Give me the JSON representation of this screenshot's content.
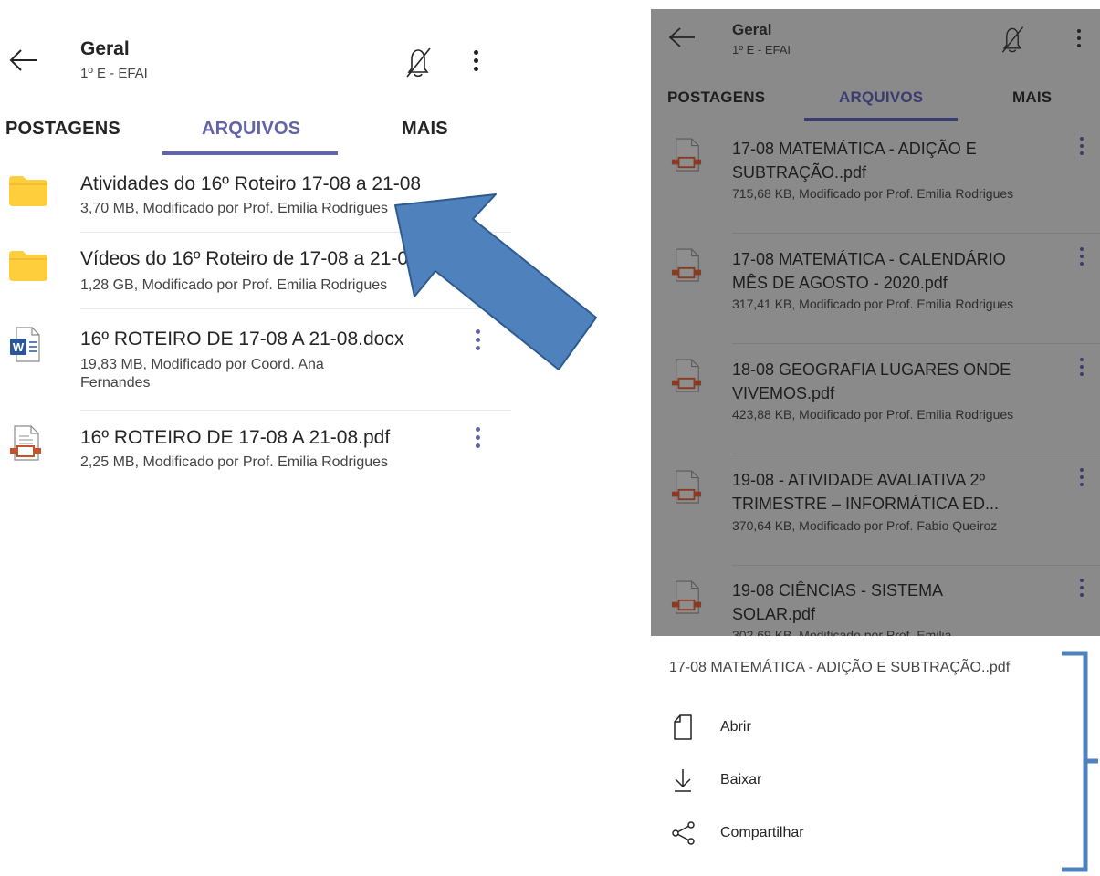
{
  "left": {
    "header": {
      "title": "Geral",
      "subtitle": "1º E - EFAI"
    },
    "tabs": [
      {
        "label": "POSTAGENS",
        "active": false
      },
      {
        "label": "ARQUIVOS",
        "active": true
      },
      {
        "label": "MAIS",
        "active": false
      }
    ],
    "files": [
      {
        "type": "folder",
        "name": "Atividades do 16º Roteiro 17-08 a 21-08",
        "meta": "3,70 MB, Modificado por Prof. Emilia Rodrigues"
      },
      {
        "type": "folder",
        "name": "Vídeos do 16º Roteiro de 17-08 a 21-08",
        "meta": "1,28 GB, Modificado por Prof. Emilia Rodrigues"
      },
      {
        "type": "docx",
        "name": "16º ROTEIRO DE 17-08 A 21-08.docx",
        "meta": "19,83 MB, Modificado por Coord. Ana Fernandes"
      },
      {
        "type": "pdf",
        "name": "16º ROTEIRO DE 17-08 A 21-08.pdf",
        "meta": "2,25 MB, Modificado por Prof. Emilia Rodrigues"
      }
    ]
  },
  "right": {
    "header": {
      "title": "Geral",
      "subtitle": "1º E - EFAI"
    },
    "tabs": [
      {
        "label": "POSTAGENS",
        "active": false
      },
      {
        "label": "ARQUIVOS",
        "active": true
      },
      {
        "label": "MAIS",
        "active": false
      }
    ],
    "files": [
      {
        "name": "17-08 MATEMÁTICA - ADIÇÃO E SUBTRAÇÃO..pdf",
        "meta": "715,68 KB, Modificado por Prof. Emilia Rodrigues"
      },
      {
        "name": "17-08 MATEMÁTICA - CALENDÁRIO MÊS DE AGOSTO - 2020.pdf",
        "meta": "317,41 KB, Modificado por Prof. Emilia Rodrigues"
      },
      {
        "name": "18-08 GEOGRAFIA LUGARES ONDE VIVEMOS.pdf",
        "meta": "423,88 KB, Modificado por Prof. Emilia Rodrigues"
      },
      {
        "name": "19-08 - ATIVIDADE AVALIATIVA 2º TRIMESTRE – INFORMÁTICA ED...",
        "meta": "370,64 KB, Modificado por Prof. Fabio Queiroz"
      },
      {
        "name": "19-08 CIÊNCIAS - SISTEMA SOLAR.pdf",
        "meta": "302,69 KB, Modificado por Prof. Emilia"
      }
    ],
    "sheet": {
      "title": "17-08 MATEMÁTICA - ADIÇÃO E SUBTRAÇÃO..pdf",
      "actions": [
        {
          "label": "Abrir",
          "icon": "file-icon"
        },
        {
          "label": "Baixar",
          "icon": "download-icon"
        },
        {
          "label": "Compartilhar",
          "icon": "share-icon"
        }
      ]
    }
  },
  "colors": {
    "accent": "#6264a7",
    "folder": "#ffce3d",
    "word": "#2b579a",
    "pdf": "#c4532c",
    "annotation": "#4f81bd",
    "overlay": "#8a8a8a"
  }
}
